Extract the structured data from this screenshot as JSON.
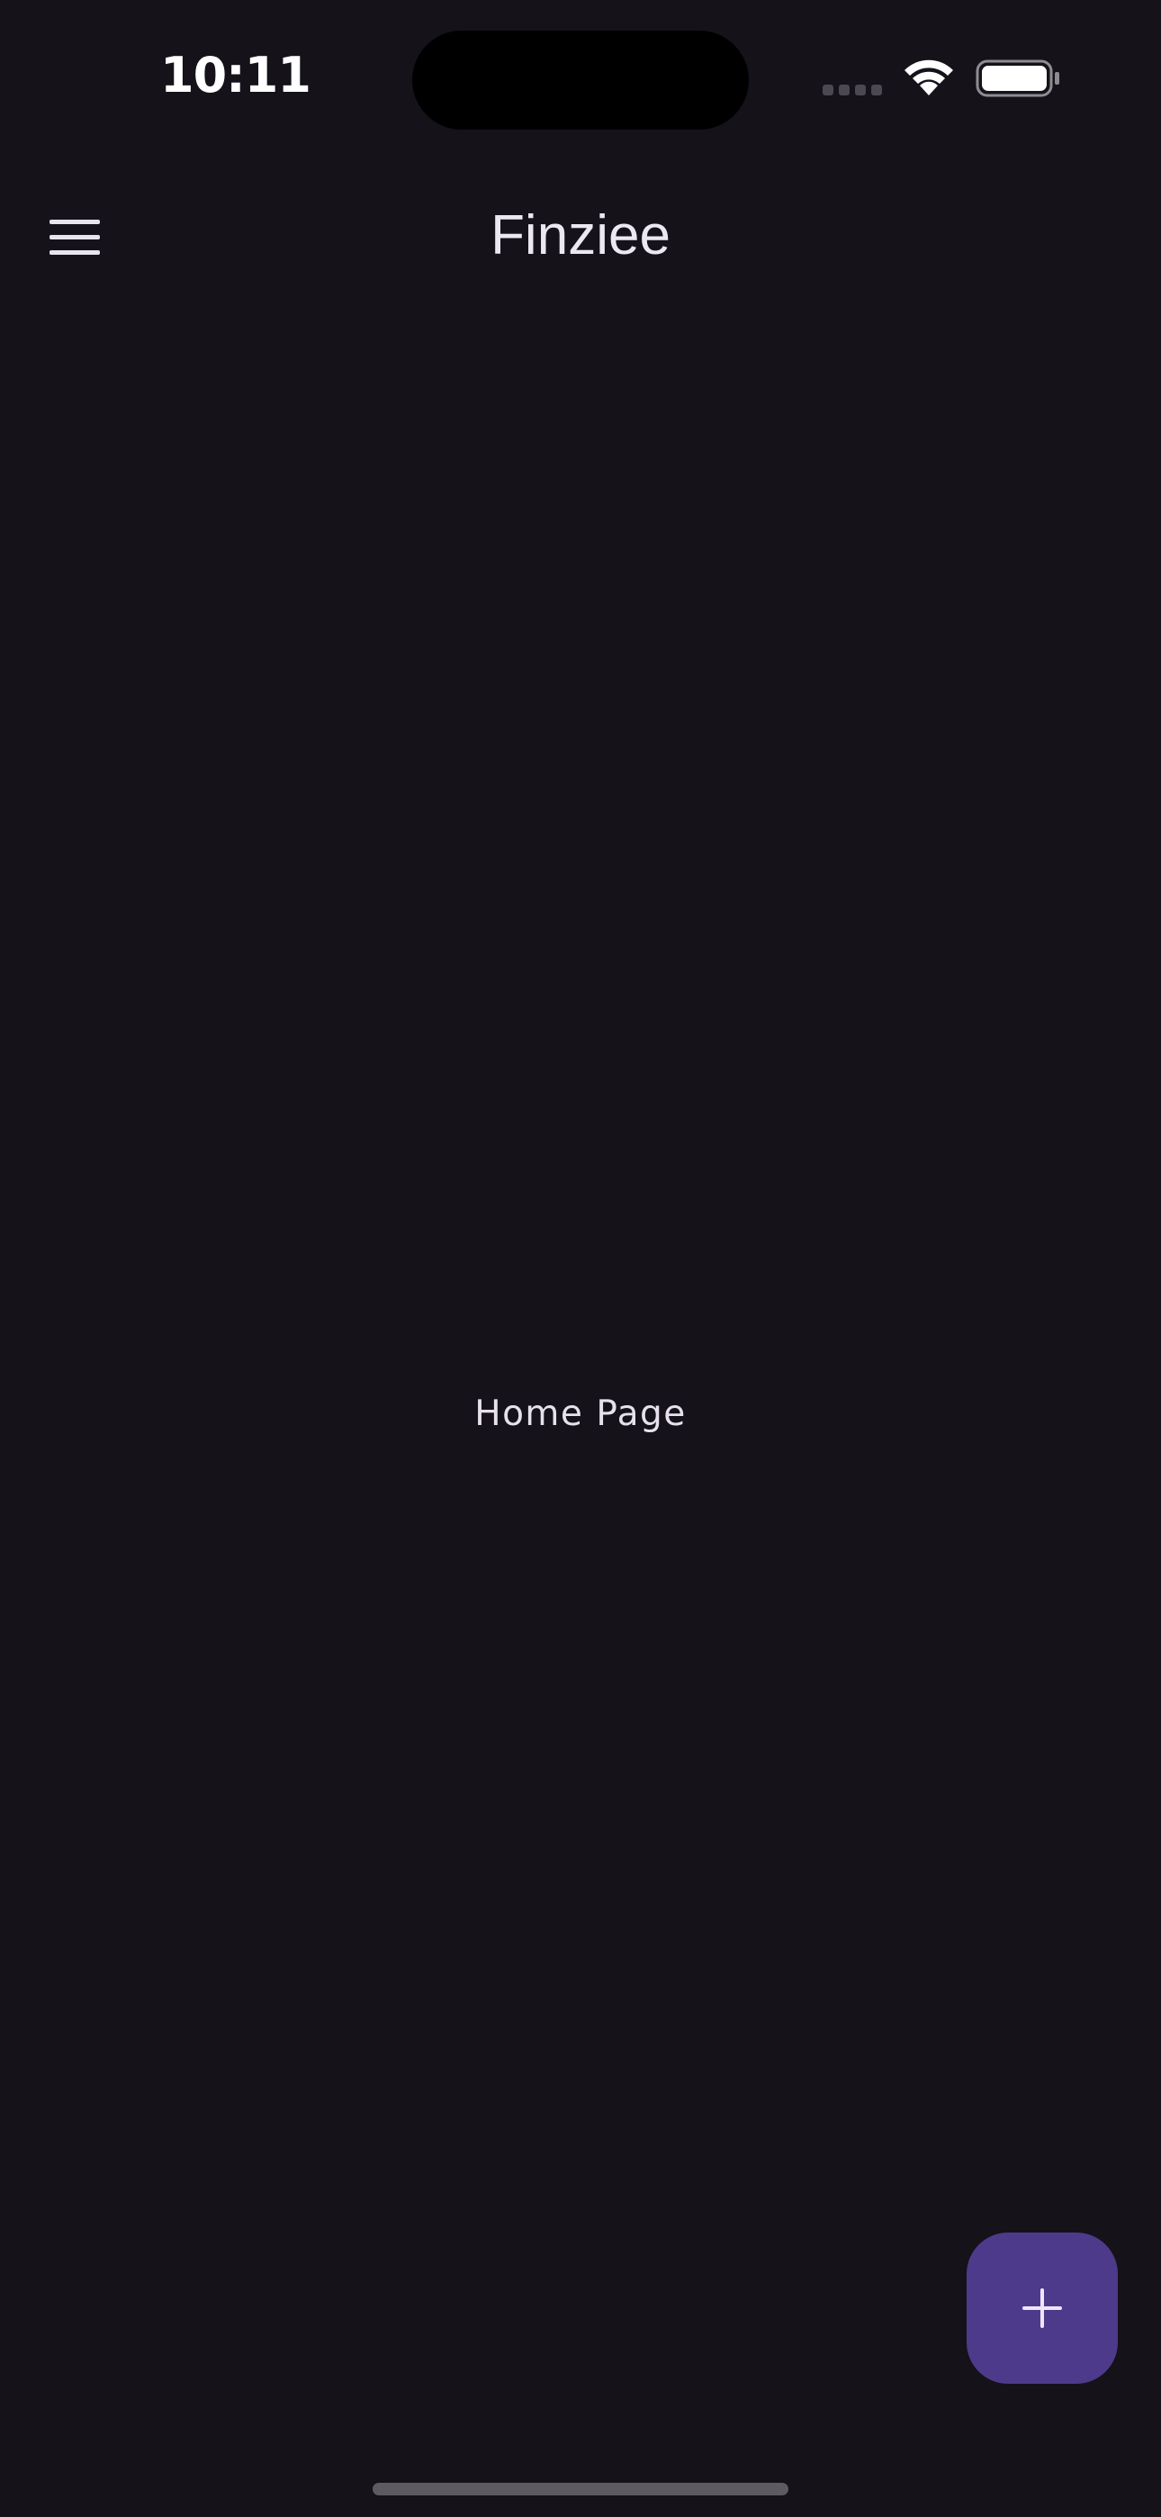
{
  "status_bar": {
    "time": "10:11",
    "signal_icon": "cellular-signal-icon",
    "wifi_icon": "wifi-icon",
    "battery_icon": "battery-full-icon"
  },
  "app_bar": {
    "menu_icon": "hamburger-menu-icon",
    "title": "Finziee"
  },
  "main": {
    "body_text": "Home Page"
  },
  "fab": {
    "icon": "plus-icon"
  },
  "colors": {
    "background": "#15121a",
    "fab": "#4e3a8a",
    "text": "#e8e4ee"
  }
}
